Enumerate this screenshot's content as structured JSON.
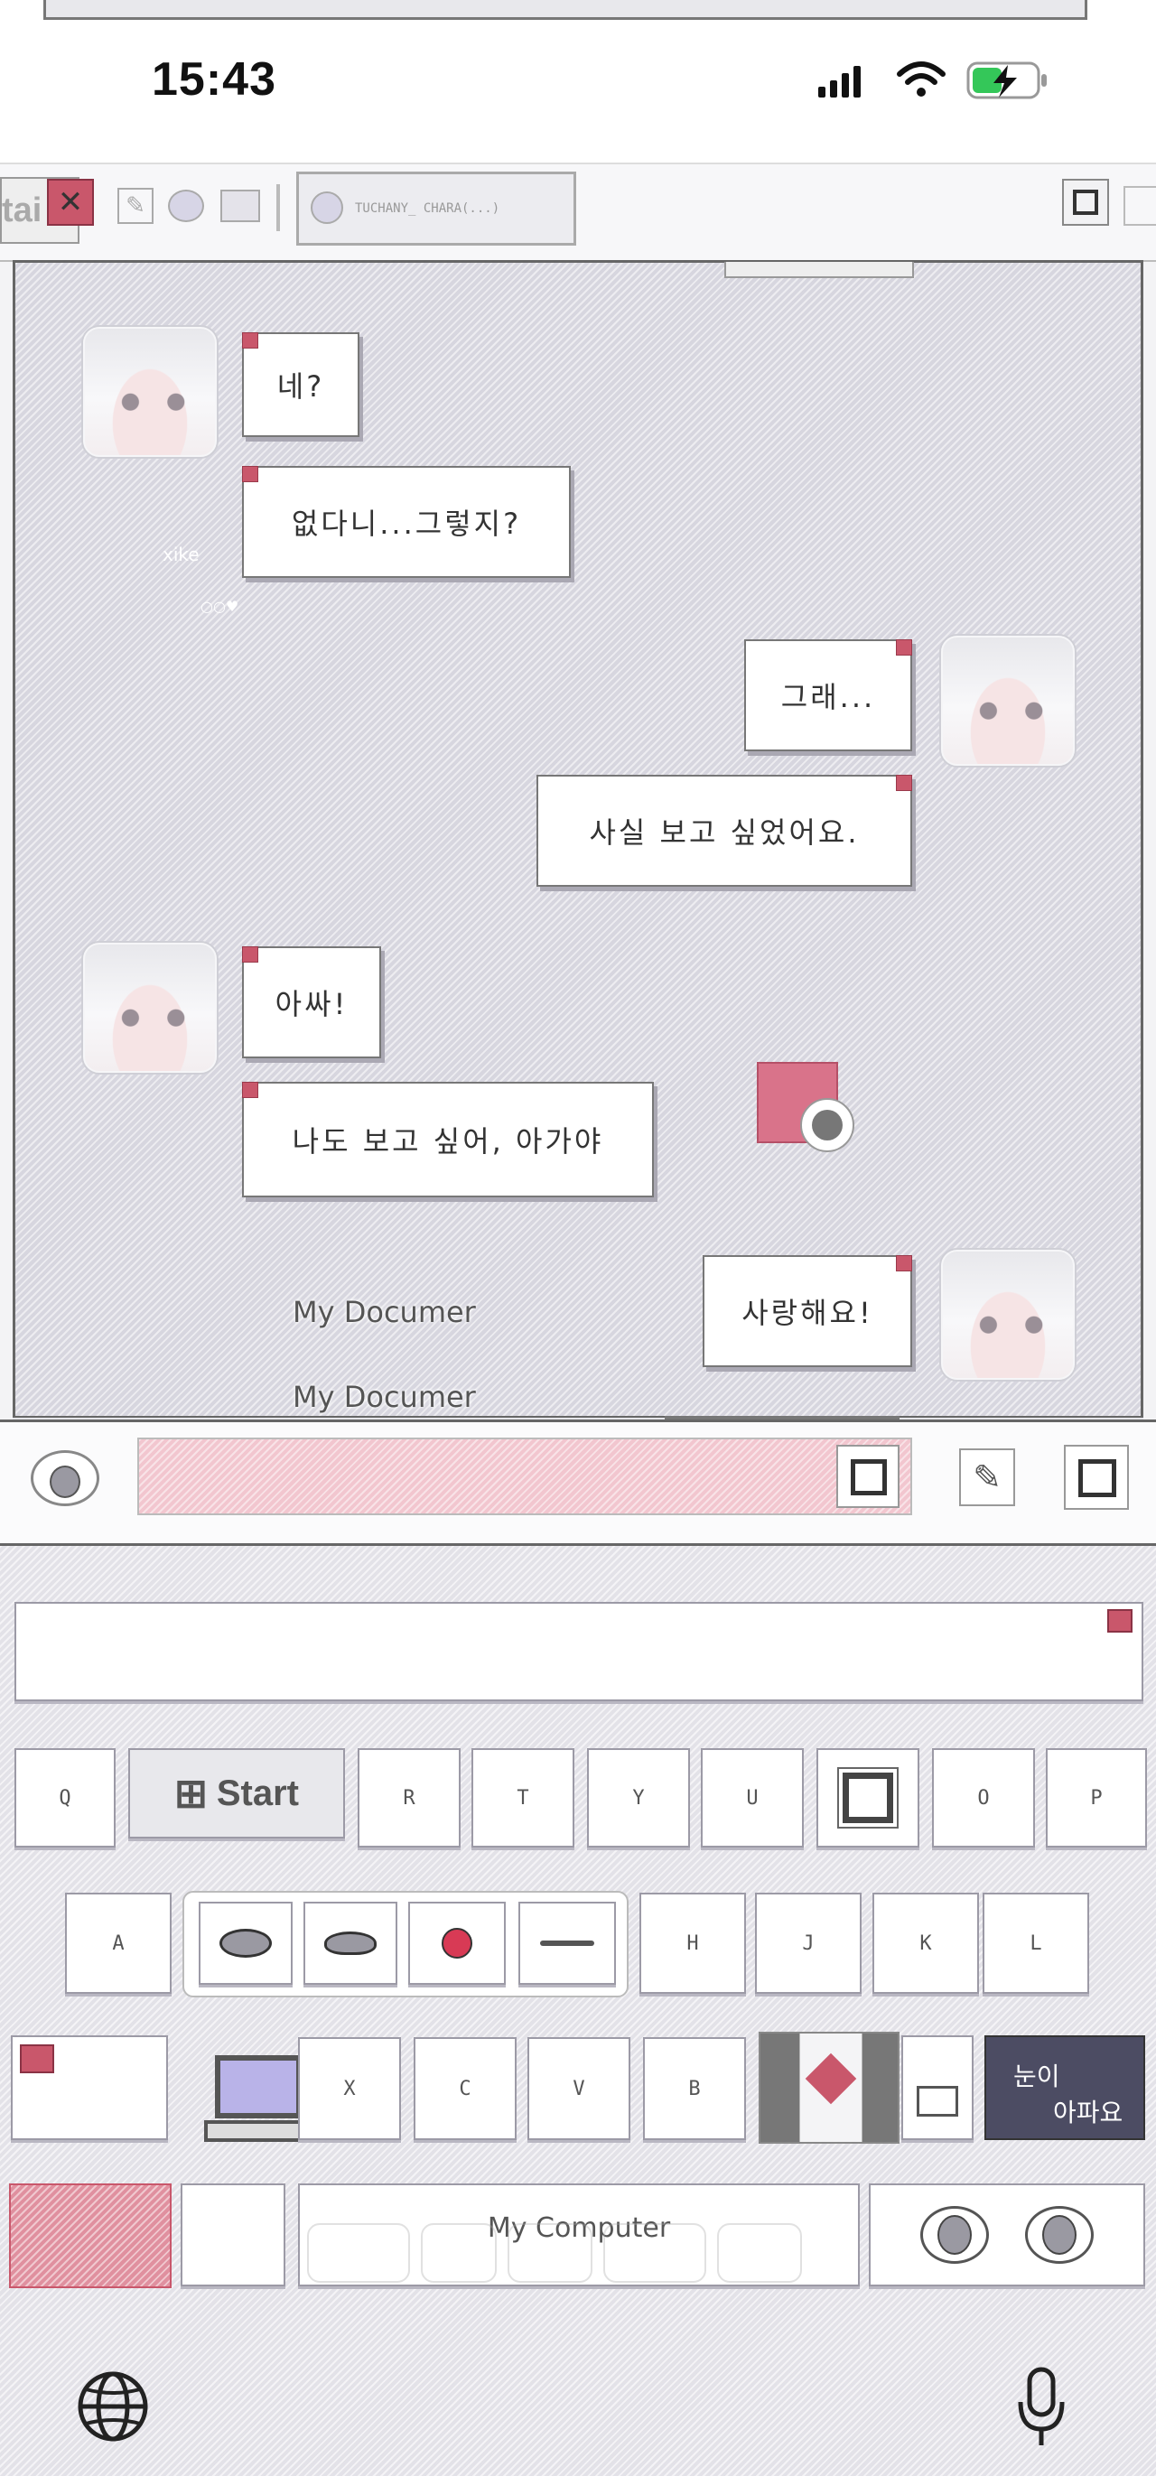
{
  "status_bar": {
    "time": "15:43"
  },
  "taskbar": {
    "start_fragment": "tai",
    "tab_label": "TUCHANY_ CHARA(...)"
  },
  "chat": {
    "messages": [
      {
        "side": "left",
        "text": "네?"
      },
      {
        "side": "left",
        "text": "없다니...그렇지?"
      },
      {
        "side": "right",
        "text": "그래..."
      },
      {
        "side": "right",
        "text": "사실 보고 싶었어요."
      },
      {
        "side": "left",
        "text": "아싸!"
      },
      {
        "side": "left",
        "text": "나도 보고 싶어, 아가야"
      },
      {
        "side": "right",
        "text": "사랑해요!"
      }
    ],
    "overlay": {
      "doc_label_1": "My Documer",
      "doc_label_2": "My Documer",
      "faint_name": "xike"
    }
  },
  "input": {
    "placeholder": ""
  },
  "keyboard": {
    "row1": [
      "Q",
      "R",
      "T",
      "Y",
      "U",
      "O",
      "P"
    ],
    "start_label": "Start",
    "row2": [
      "A",
      "H",
      "J",
      "K",
      "L"
    ],
    "row3": [
      "X",
      "C",
      "V",
      "B"
    ],
    "dark_key_line1": "눈이",
    "dark_key_line2": "아파요",
    "computer_label": "My Computer"
  },
  "colors": {
    "accent_pink": "#c9576b",
    "keyboard_bg": "#d7d6df"
  }
}
